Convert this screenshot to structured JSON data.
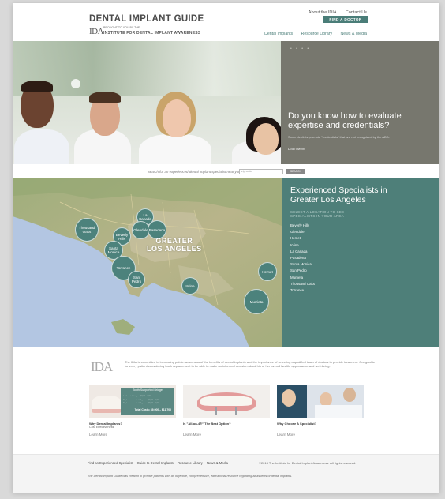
{
  "header": {
    "title": "DENTAL IMPLANT GUIDE",
    "logo_mark": "IDA",
    "tagline_small": "BROUGHT TO YOU BY THE",
    "institute": "INSTITUTE FOR DENTAL IMPLANT AWARENESS",
    "top_links": [
      "About the IDIA",
      "Contact Us"
    ],
    "find_button": "FIND A DOCTOR",
    "nav": [
      "Dental Implants",
      "Resource Library",
      "News & Media"
    ]
  },
  "hero": {
    "headline": "Do you know how to evaluate expertise and credentials?",
    "body": "Some dentists promote \"credentials\" that are not recognized by the ADA.",
    "more": "Learn More",
    "pager": "• • • •"
  },
  "search": {
    "label": "Search for an experienced dental implant specialist near you",
    "placeholder": "zip code",
    "button": "SEARCH"
  },
  "map": {
    "region_line1": "GREATER",
    "region_line2": "LOS ANGELES",
    "pins": [
      {
        "label": "Thousand Oaks"
      },
      {
        "label": "La Canada"
      },
      {
        "label": "Glendale"
      },
      {
        "label": "Pasadena"
      },
      {
        "label": "Beverly Hills"
      },
      {
        "label": "Santa Monica"
      },
      {
        "label": "Torrance"
      },
      {
        "label": "San Pedro"
      },
      {
        "label": "Irvine"
      },
      {
        "label": "Hemet"
      },
      {
        "label": "Murrieta"
      }
    ]
  },
  "specialists": {
    "heading": "Experienced Specialists in Greater Los Angeles",
    "subheading": "SELECT A LOCATION TO SEE SPECIALISTS IN YOUR AREA",
    "locations": [
      "Beverly Hills",
      "Glendale",
      "Hemet",
      "Irvine",
      "La Canada",
      "Pasadena",
      "Santa Monica",
      "San Pedro",
      "Murrieta",
      "Thousand Oaks",
      "Torrance"
    ]
  },
  "about": {
    "logo": "IDA",
    "text": "The IDIA is committed to increasing public awareness of the benefits of dental implants and the importance of selecting a qualified team of doctors to provide treatment. Our goal is for every patient considering tooth replacement to be able to make an informed decision about his or her overall health, appearance and well-being."
  },
  "cards": [
    {
      "title": "Why Dental Implants?",
      "subtitle": "Cost Effectiveness",
      "more": "Learn More",
      "overlay_title": "Tooth Supported Bridge",
      "overlay_lines": [
        "Initial cost of bridge = $2,500 – 3,300",
        "Replacement cost at 10 years = $2,800 – 3,300",
        "Replacement cost at 20 years = $2,800 – 3,300"
      ],
      "overlay_total": "Total Cost = $9,000 – $11,700"
    },
    {
      "title": "Is \"All-on-4®\" The Best Option?",
      "more": "Learn More"
    },
    {
      "title": "Why Choose A Specialist?",
      "more": "Learn More"
    }
  ],
  "footer": {
    "links": [
      "Find an Experienced Specialist",
      "Guide to Dental Implants",
      "Resource Library",
      "News & Media"
    ],
    "copyright": "©2013 The Institute for Dental Implant Awareness. All rights reserved.",
    "note": "The Dental Implant Guide was created to provide patients with an objective, comprehensive, educational resource regarding all aspects of dental implants."
  },
  "colors": {
    "accent": "#4e7f79",
    "hero_panel": "#77776e"
  }
}
